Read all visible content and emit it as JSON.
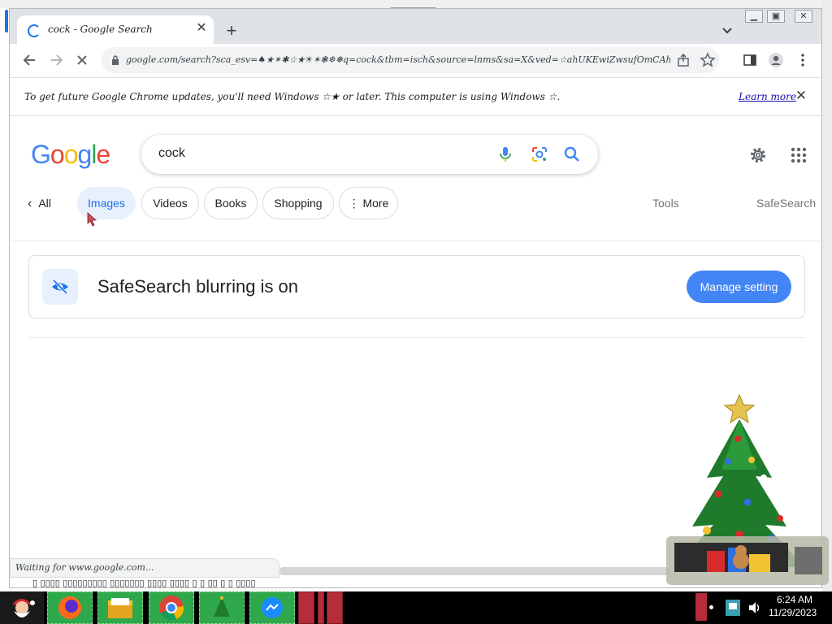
{
  "browser": {
    "tab_title": "cock - Google Search",
    "new_tab_symbol": "+",
    "url": "google.com/search?sca_esv=♠★✴✱☆★☀✶❃❄❅q=cock&tbm=isch&source=lnms&sa=X&ved=☆ahUKEwiZwsufOmCAhVWckGHa-UBPEQ☆pQJegQIGE...",
    "reload_symbol": "✕"
  },
  "infobar": {
    "message": "To get future Google Chrome updates, you'll need Windows ☆★ or later. This computer is using Windows ☆.",
    "learn_more": "Learn more"
  },
  "search": {
    "query": "cock"
  },
  "tabs": {
    "back_all": "All",
    "images": "Images",
    "videos": "Videos",
    "books": "Books",
    "shopping": "Shopping",
    "more": "More",
    "tools": "Tools",
    "safesearch": "SafeSearch"
  },
  "safesearch_card": {
    "message": "SafeSearch blurring is on",
    "button": "Manage setting"
  },
  "status": {
    "loading": "Waiting for www.google.com..."
  },
  "taskbar": {
    "time": "6:24 AM",
    "date": "11/29/2023"
  },
  "colors": {
    "google_blue": "#4285f4",
    "google_red": "#ea4335",
    "google_yellow": "#fbbc05",
    "google_green": "#34a853",
    "taskbar_green": "#2ea84a",
    "taskbar_red": "#b62c3a"
  },
  "icons": [
    "spinner-icon",
    "close-icon",
    "plus-icon",
    "chevron-down-icon",
    "back-arrow-icon",
    "forward-arrow-icon",
    "stop-icon",
    "lock-icon",
    "share-icon",
    "star-icon",
    "sidepanel-icon",
    "profile-icon",
    "kebab-icon",
    "mic-icon",
    "lens-icon",
    "search-icon",
    "gear-icon",
    "apps-icon",
    "eye-off-icon"
  ]
}
